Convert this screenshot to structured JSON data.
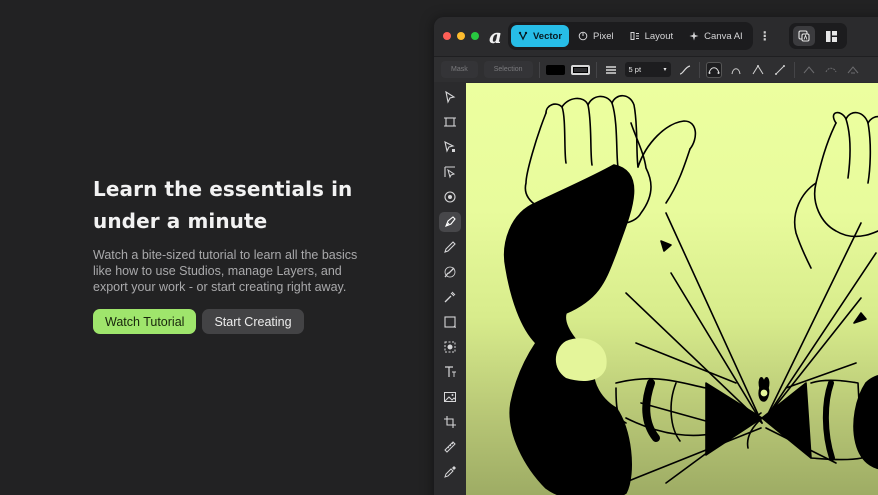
{
  "intro": {
    "title": "Learn the essentials in under a minute",
    "description": "Watch a bite-sized tutorial to learn all the basics like how to use Studios, manage Layers, and export your work - or start creating right away.",
    "watch_label": "Watch Tutorial",
    "start_label": "Start Creating"
  },
  "app": {
    "logo_text": "a",
    "persona_tabs": [
      {
        "label": "Vector",
        "icon": "vector-pen-icon",
        "active": true
      },
      {
        "label": "Pixel",
        "icon": "pixel-circle-icon",
        "active": false
      },
      {
        "label": "Layout",
        "icon": "layout-columns-icon",
        "active": false
      },
      {
        "label": "Canva AI",
        "icon": "sparkle-icon",
        "active": false
      }
    ],
    "more_label": "⋮",
    "context": {
      "mask_label": "Mask",
      "selection_label": "Selection",
      "stroke_weight": "5 pt"
    }
  },
  "colors": {
    "accent": "#27bde7",
    "primary_button": "#9fe56c",
    "secondary_button": "#434345",
    "canvas_top": "#ecff9f",
    "canvas_bottom": "#9aa862",
    "traffic_red": "#fe5f57",
    "traffic_yellow": "#febc2e",
    "traffic_green": "#28c840"
  }
}
